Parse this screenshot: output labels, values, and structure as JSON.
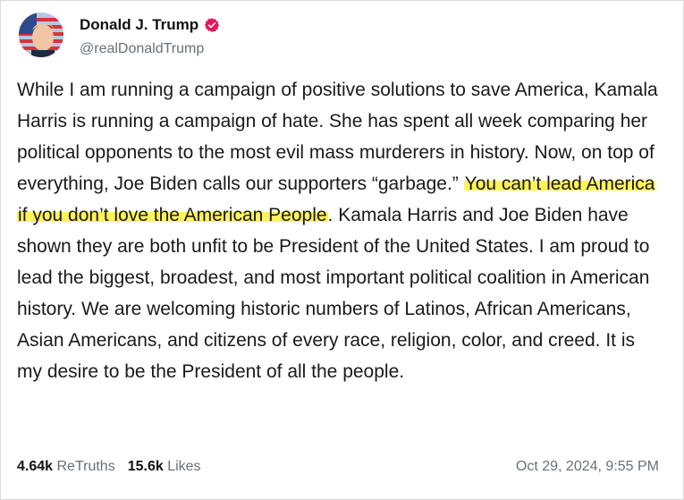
{
  "post": {
    "author": {
      "display_name": "Donald J. Trump",
      "handle": "@realDonaldTrump",
      "verified": true,
      "verified_color": "#e5175f"
    },
    "body_before": "While I am running a campaign of positive solutions to save America, Kamala Harris is running a campaign of hate. She has spent all week comparing her political opponents to the most evil mass murderers in history. Now, on top of everything, Joe Biden calls our supporters “garbage.” ",
    "body_highlight": "You can’t lead America if you don’t love the American People",
    "body_after": ". Kamala Harris and Joe Biden have shown they are both unfit to be President of the United States. I am proud to lead the biggest, broadest, and most important political coalition in American history. We are welcoming historic numbers of Latinos, African Americans, Asian Americans, and citizens of every race, religion, color, and creed. It is my desire to be the President of all the people.",
    "highlight_color": "#fff35a",
    "stats": {
      "retruths_count": "4.64k",
      "retruths_label": "ReTruths",
      "likes_count": "15.6k",
      "likes_label": "Likes"
    },
    "timestamp": "Oct 29, 2024, 9:55 PM"
  }
}
